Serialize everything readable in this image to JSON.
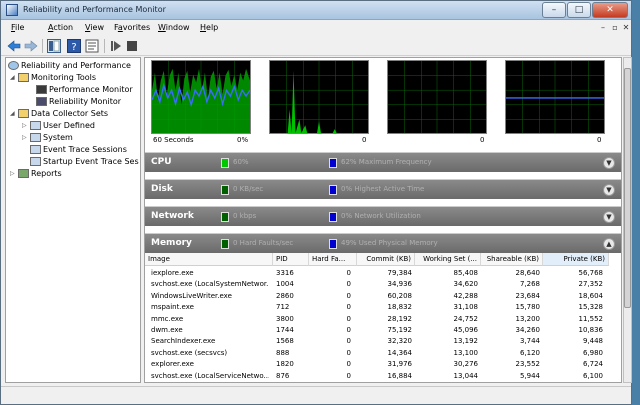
{
  "window": {
    "title": "Reliability and Performance Monitor"
  },
  "menu": [
    {
      "label": "File",
      "accel": "F",
      "rest": "ile"
    },
    {
      "label": "Action",
      "accel": "A",
      "rest": "ction"
    },
    {
      "label": "View",
      "accel": "V",
      "rest": "iew"
    },
    {
      "label": "Favorites",
      "accel": "a",
      "pre": "F",
      "rest": "vorites"
    },
    {
      "label": "Window",
      "accel": "W",
      "rest": "indow"
    },
    {
      "label": "Help",
      "accel": "H",
      "rest": "elp"
    }
  ],
  "tree": {
    "root": "Reliability and Performance",
    "monitoring_tools": "Monitoring Tools",
    "performance_monitor": "Performance Monitor",
    "reliability_monitor": "Reliability Monitor",
    "data_collector_sets": "Data Collector Sets",
    "user_defined": "User Defined",
    "system": "System",
    "event_trace_sessions": "Event Trace Sessions",
    "startup_event_trace": "Startup Event Trace Ses",
    "reports": "Reports"
  },
  "graphs": {
    "cpu_left": "60 Seconds",
    "cpu_right": "0%",
    "disk_right": "0",
    "net_right": "0",
    "mem_right": "0"
  },
  "sections": {
    "cpu": {
      "name": "CPU",
      "value": "60%",
      "value2": "62% Maximum Frequency"
    },
    "disk": {
      "name": "Disk",
      "value": "0 KB/sec",
      "value2": "0% Highest Active Time"
    },
    "network": {
      "name": "Network",
      "value": "0 kbps",
      "value2": "0% Network Utilization"
    },
    "memory": {
      "name": "Memory",
      "value": "0 Hard Faults/sec",
      "value2": "49% Used Physical Memory"
    }
  },
  "colors": {
    "green": "#00c800",
    "blue": "#0000d0",
    "cpu_line": "#3a6cff"
  },
  "table": {
    "headers": [
      "Image",
      "PID",
      "Hard Fa...",
      "Commit (KB)",
      "Working Set (...",
      "Shareable (KB)",
      "Private (KB)"
    ],
    "rows": [
      [
        "iexplore.exe",
        "3316",
        "0",
        "79,384",
        "85,408",
        "28,640",
        "56,768"
      ],
      [
        "svchost.exe (LocalSystemNetwor...",
        "1004",
        "0",
        "34,936",
        "34,620",
        "7,268",
        "27,352"
      ],
      [
        "WindowsLiveWriter.exe",
        "2860",
        "0",
        "60,208",
        "42,288",
        "23,684",
        "18,604"
      ],
      [
        "mspaint.exe",
        "712",
        "0",
        "18,832",
        "31,108",
        "15,780",
        "15,328"
      ],
      [
        "mmc.exe",
        "3800",
        "0",
        "28,192",
        "24,752",
        "13,200",
        "11,552"
      ],
      [
        "dwm.exe",
        "1744",
        "0",
        "75,192",
        "45,096",
        "34,260",
        "10,836"
      ],
      [
        "SearchIndexer.exe",
        "1568",
        "0",
        "32,320",
        "13,192",
        "3,744",
        "9,448"
      ],
      [
        "svchost.exe (secsvcs)",
        "888",
        "0",
        "14,364",
        "13,100",
        "6,120",
        "6,980"
      ],
      [
        "explorer.exe",
        "1820",
        "0",
        "31,976",
        "30,276",
        "23,552",
        "6,724"
      ],
      [
        "svchost.exe (LocalServiceNetwo...",
        "876",
        "0",
        "16,884",
        "13,044",
        "5,944",
        "6,100"
      ]
    ]
  }
}
